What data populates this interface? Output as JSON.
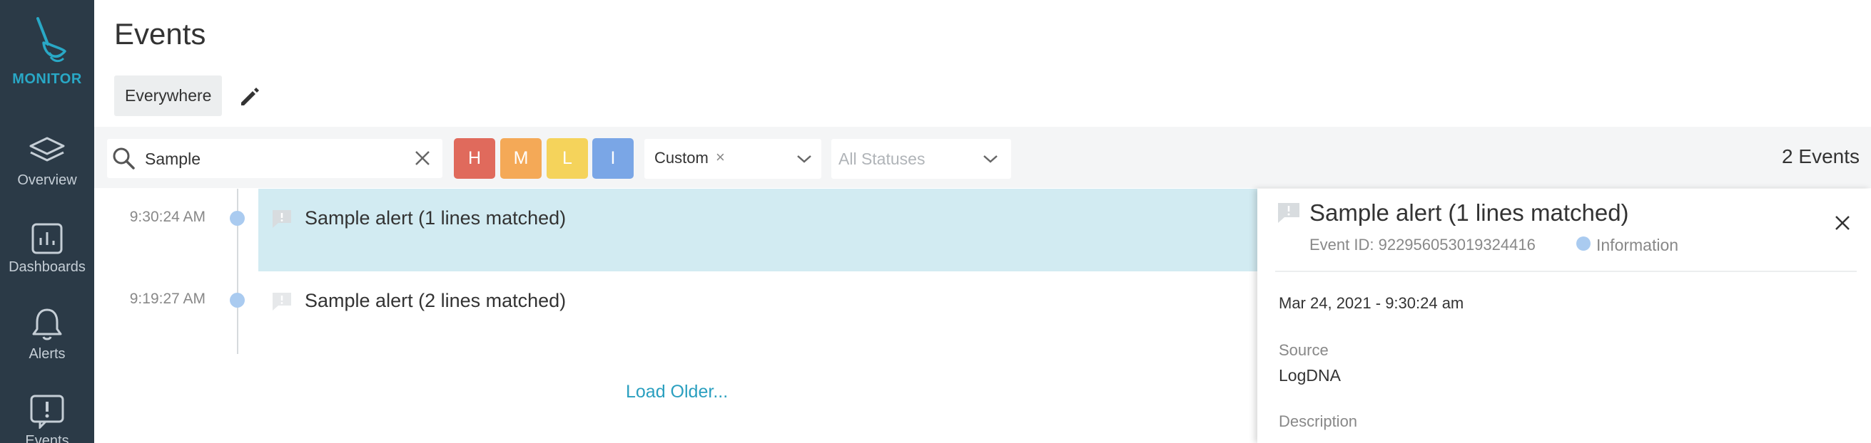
{
  "sidebar": {
    "brand_label": "MONITOR",
    "items": [
      {
        "label": "Overview",
        "icon": "layers-icon"
      },
      {
        "label": "Dashboards",
        "icon": "bar-chart-icon"
      },
      {
        "label": "Alerts",
        "icon": "bell-icon"
      },
      {
        "label": "Events",
        "icon": "events-icon"
      }
    ]
  },
  "header": {
    "title": "Events",
    "scope": "Everywhere"
  },
  "filters": {
    "search_value": "Sample",
    "severities": [
      {
        "label": "H",
        "color": "#e06a5c"
      },
      {
        "label": "M",
        "color": "#f4a957"
      },
      {
        "label": "L",
        "color": "#f5d35b"
      },
      {
        "label": "I",
        "color": "#7aa6e6"
      }
    ],
    "time_range": "Custom",
    "status_placeholder": "All Statuses",
    "event_count": "2 Events"
  },
  "events": [
    {
      "time": "9:30:24 AM",
      "title": "Sample alert (1 lines matched)",
      "selected": true
    },
    {
      "time": "9:19:27 AM",
      "title": "Sample alert (2 lines matched)",
      "selected": false
    }
  ],
  "load_older": "Load Older...",
  "detail": {
    "title": "Sample alert (1 lines matched)",
    "event_id": "Event ID: 922956053019324416",
    "severity": "Information",
    "date": "Mar 24, 2021 - 9:30:24 am",
    "source_label": "Source",
    "source_value": "LogDNA",
    "description_label": "Description"
  },
  "colors": {
    "sidebar_bg": "#2b3a47",
    "accent": "#29a8c6",
    "selected_row": "#d2ebf2"
  }
}
